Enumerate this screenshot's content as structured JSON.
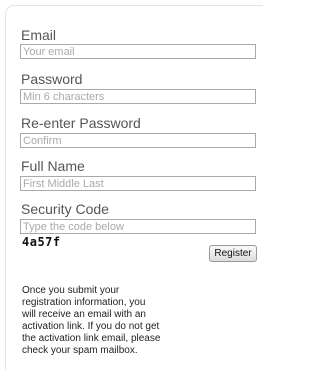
{
  "form": {
    "email": {
      "label": "Email",
      "placeholder": "Your email"
    },
    "password": {
      "label": "Password",
      "placeholder": "Min 6 characters"
    },
    "confirm": {
      "label": "Re-enter Password",
      "placeholder": "Confirm"
    },
    "full_name": {
      "label": "Full Name",
      "placeholder": "First Middle Last"
    },
    "security": {
      "label": "Security Code",
      "placeholder": "Type the code below",
      "code": "4a57f"
    },
    "register_label": "Register"
  },
  "info_lines": [
    "Once you submit your",
    "registration information, you",
    "will receive an email with an",
    "activation link. If you do not get",
    "the activation link email, please",
    "check your spam mailbox."
  ]
}
